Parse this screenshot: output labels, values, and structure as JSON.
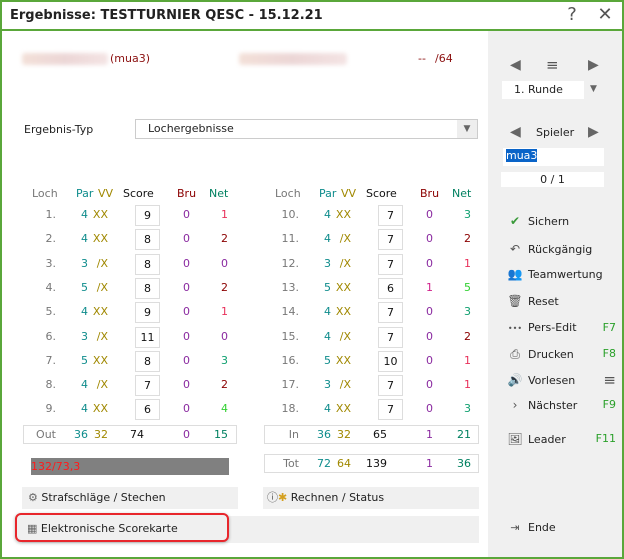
{
  "window": {
    "title": "Ergebnisse: TESTTURNIER QESC - 15.12.21",
    "help": "?",
    "close": "✕"
  },
  "player": {
    "id": "(mua3)",
    "dashes": "--",
    "hcp": "/64"
  },
  "result_type": {
    "label": "Ergebnis-Typ",
    "value": "Lochergebnisse"
  },
  "headers": {
    "loch": "Loch",
    "par": "Par",
    "vv": "VV",
    "score": "Score",
    "bru": "Bru",
    "net": "Net"
  },
  "front": [
    {
      "loch": "1.",
      "par": "4",
      "vv": "XX",
      "score": "9",
      "bru": "0",
      "net": "1"
    },
    {
      "loch": "2.",
      "par": "4",
      "vv": "XX",
      "score": "8",
      "bru": "0",
      "net": "2"
    },
    {
      "loch": "3.",
      "par": "3",
      "vv": "/X",
      "score": "8",
      "bru": "0",
      "net": "0"
    },
    {
      "loch": "4.",
      "par": "5",
      "vv": "/X",
      "score": "8",
      "bru": "0",
      "net": "2"
    },
    {
      "loch": "5.",
      "par": "4",
      "vv": "XX",
      "score": "9",
      "bru": "0",
      "net": "1"
    },
    {
      "loch": "6.",
      "par": "3",
      "vv": "/X",
      "score": "11",
      "bru": "0",
      "net": "0"
    },
    {
      "loch": "7.",
      "par": "5",
      "vv": "XX",
      "score": "8",
      "bru": "0",
      "net": "3"
    },
    {
      "loch": "8.",
      "par": "4",
      "vv": "/X",
      "score": "7",
      "bru": "0",
      "net": "2"
    },
    {
      "loch": "9.",
      "par": "4",
      "vv": "XX",
      "score": "6",
      "bru": "0",
      "net": "4"
    }
  ],
  "back": [
    {
      "loch": "10.",
      "par": "4",
      "vv": "XX",
      "score": "7",
      "bru": "0",
      "net": "3"
    },
    {
      "loch": "11.",
      "par": "4",
      "vv": "/X",
      "score": "7",
      "bru": "0",
      "net": "2"
    },
    {
      "loch": "12.",
      "par": "3",
      "vv": "/X",
      "score": "7",
      "bru": "0",
      "net": "1"
    },
    {
      "loch": "13.",
      "par": "5",
      "vv": "XX",
      "score": "6",
      "bru": "1",
      "net": "5"
    },
    {
      "loch": "14.",
      "par": "4",
      "vv": "XX",
      "score": "7",
      "bru": "0",
      "net": "3"
    },
    {
      "loch": "15.",
      "par": "4",
      "vv": "/X",
      "score": "7",
      "bru": "0",
      "net": "2"
    },
    {
      "loch": "16.",
      "par": "5",
      "vv": "XX",
      "score": "10",
      "bru": "0",
      "net": "1"
    },
    {
      "loch": "17.",
      "par": "3",
      "vv": "/X",
      "score": "7",
      "bru": "0",
      "net": "1"
    },
    {
      "loch": "18.",
      "par": "4",
      "vv": "XX",
      "score": "7",
      "bru": "0",
      "net": "3"
    }
  ],
  "out": {
    "loch": "Out",
    "par": "36",
    "vv": "32",
    "score": "74",
    "bru": "0",
    "net": "15"
  },
  "in": {
    "loch": "In",
    "par": "36",
    "vv": "32",
    "score": "65",
    "bru": "1",
    "net": "21"
  },
  "tot": {
    "loch": "Tot",
    "par": "72",
    "vv": "64",
    "score": "139",
    "bru": "1",
    "net": "36"
  },
  "course_rating": "132/73,3",
  "buttons": {
    "penalties": "Strafschläge / Stechen",
    "calc": "Rechnen / Status",
    "scorecard": "Elektronische Scorekarte"
  },
  "sidebar": {
    "round": "1. Runde",
    "player_label": "Spieler",
    "player_value": "mua3",
    "counter": "0 / 1",
    "actions": [
      {
        "label": "Sichern",
        "key": ""
      },
      {
        "label": "Rückgängig",
        "key": ""
      },
      {
        "label": "Teamwertung",
        "key": ""
      },
      {
        "label": "Reset",
        "key": ""
      },
      {
        "label": "Pers-Edit",
        "key": "F7"
      },
      {
        "label": "Drucken",
        "key": "F8"
      },
      {
        "label": "Vorlesen",
        "key": "≡"
      },
      {
        "label": "Nächster",
        "key": "F9"
      },
      {
        "label": "Leader",
        "key": "F11"
      }
    ],
    "end": "Ende"
  },
  "colors": {
    "border": "#5aa73a",
    "bru0": "#8a2aa0",
    "bru1": "#d0208a",
    "net0": "#8a2aa0",
    "net1": "#e8305a",
    "net2": "#8b0000",
    "net3": "#10a070",
    "net4": "#30d030",
    "net5": "#30d030"
  }
}
